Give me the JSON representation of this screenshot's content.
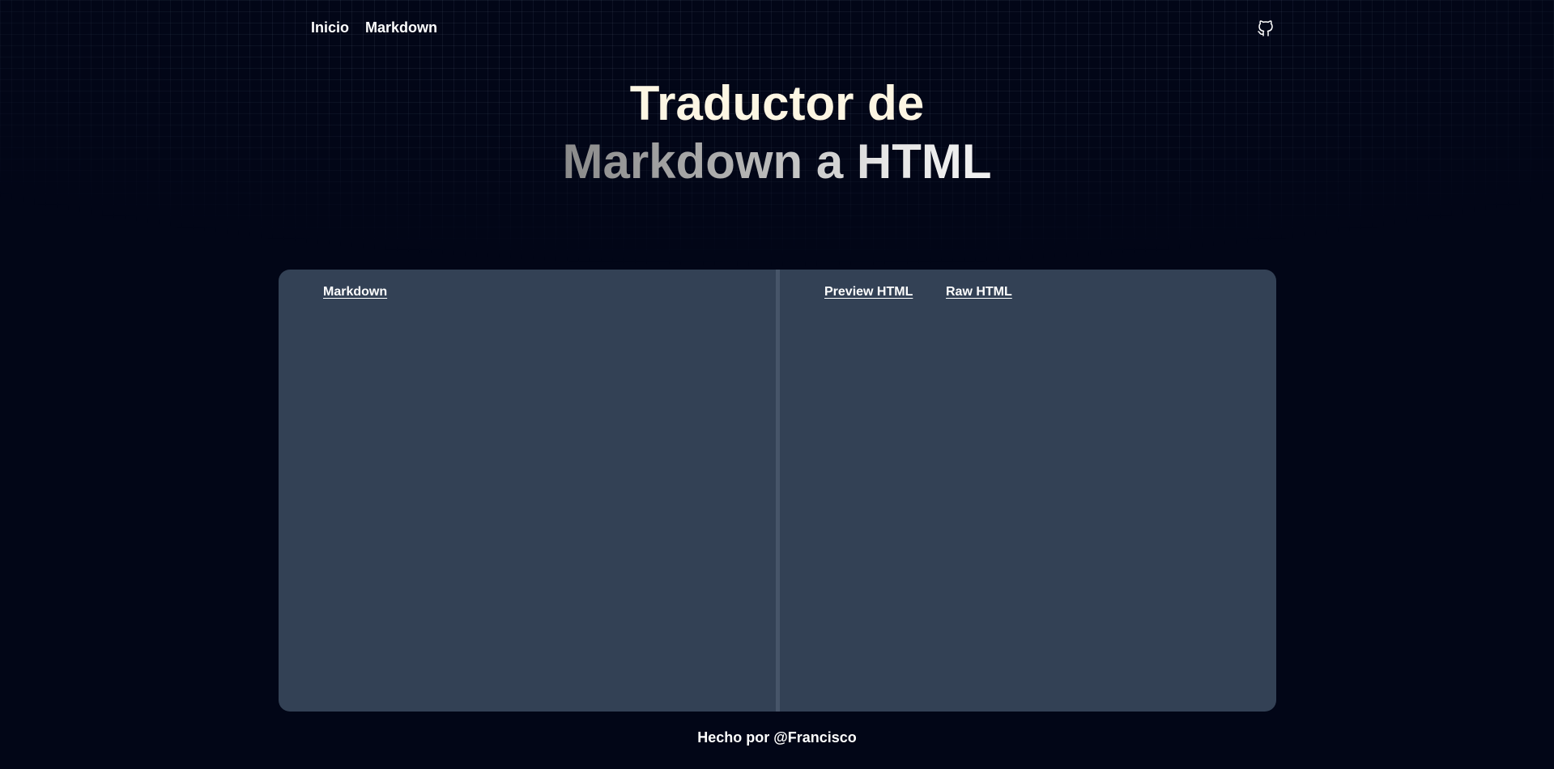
{
  "nav": {
    "home_label": "Inicio",
    "markdown_label": "Markdown",
    "github_icon": "github-icon"
  },
  "hero": {
    "line1": "Traductor de",
    "line2": "Markdown a HTML"
  },
  "editor": {
    "markdown_tab_label": "Markdown",
    "preview_tab_label": "Preview HTML",
    "raw_tab_label": "Raw HTML",
    "markdown_value": "",
    "preview_content": ""
  },
  "footer": {
    "text": "Hecho por @Francisco"
  },
  "colors": {
    "background": "#020617",
    "panel": "#334155",
    "divider": "#475569",
    "title": "#fdf6e3",
    "text": "#ffffff"
  }
}
